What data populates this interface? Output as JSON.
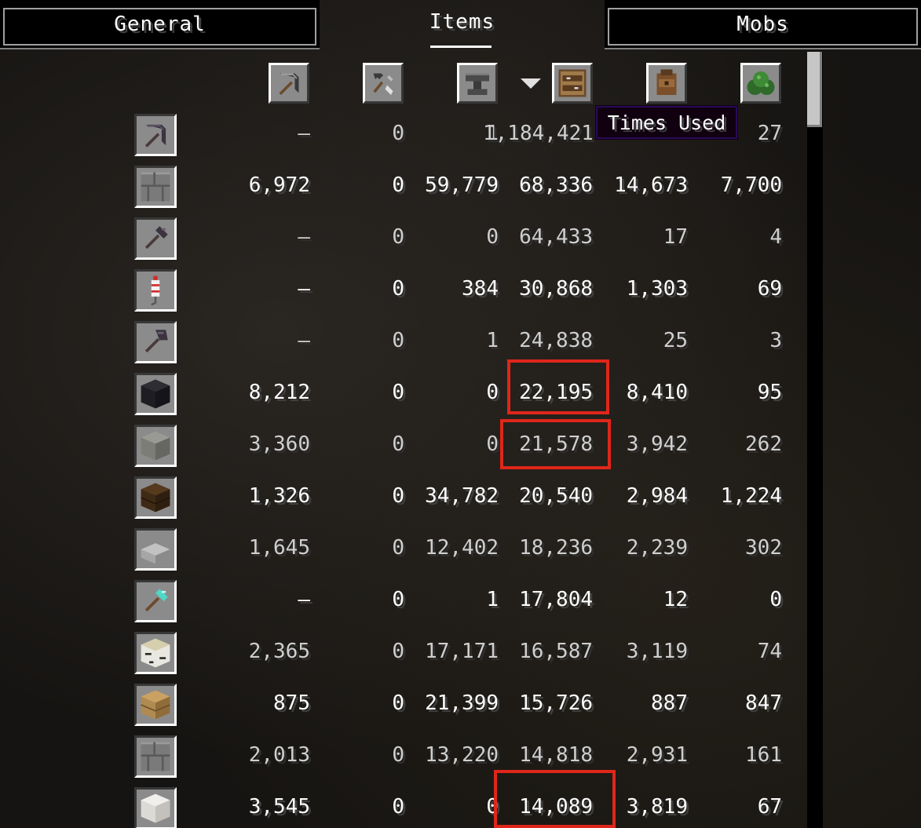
{
  "tabs": [
    {
      "label": "General",
      "active": false
    },
    {
      "label": "Items",
      "active": true
    },
    {
      "label": "Mobs",
      "active": false
    }
  ],
  "columns": [
    {
      "icon": "pickaxe-icon",
      "meaning": "Times Mined"
    },
    {
      "icon": "broken-tool-icon",
      "meaning": "Times Broken"
    },
    {
      "icon": "anvil-icon",
      "meaning": "Times Crafted"
    },
    {
      "icon": "crafting-table-icon",
      "meaning": "Times Used",
      "sorted": "descending"
    },
    {
      "icon": "backpack-icon",
      "meaning": "Times Picked Up"
    },
    {
      "icon": "bush-icon",
      "meaning": "Times Dropped"
    }
  ],
  "tooltip": "Times Used",
  "rows": [
    {
      "item": "netherite-pickaxe-icon",
      "values": [
        "–",
        "0",
        "1",
        "1,184,421",
        "",
        "27"
      ],
      "dim": true
    },
    {
      "item": "stone-bricks-icon",
      "values": [
        "6,972",
        "0",
        "59,779",
        "68,336",
        "14,673",
        "7,700"
      ],
      "dim": false
    },
    {
      "item": "netherite-shovel-icon",
      "values": [
        "–",
        "0",
        "0",
        "64,433",
        "17",
        "4"
      ],
      "dim": true
    },
    {
      "item": "firework-rocket-icon",
      "values": [
        "–",
        "0",
        "384",
        "30,868",
        "1,303",
        "69"
      ],
      "dim": false
    },
    {
      "item": "netherite-axe-icon",
      "values": [
        "–",
        "0",
        "1",
        "24,838",
        "25",
        "3"
      ],
      "dim": true
    },
    {
      "item": "blackstone-icon",
      "values": [
        "8,212",
        "0",
        "0",
        "22,195",
        "8,410",
        "95"
      ],
      "dim": false,
      "highlight": true
    },
    {
      "item": "andesite-icon",
      "values": [
        "3,360",
        "0",
        "0",
        "21,578",
        "3,942",
        "262"
      ],
      "dim": true,
      "highlight": true
    },
    {
      "item": "dark-oak-planks-icon",
      "values": [
        "1,326",
        "0",
        "34,782",
        "20,540",
        "2,984",
        "1,224"
      ],
      "dim": false
    },
    {
      "item": "smooth-stone-slab-icon",
      "values": [
        "1,645",
        "0",
        "12,402",
        "18,236",
        "2,239",
        "302"
      ],
      "dim": true
    },
    {
      "item": "diamond-shovel-icon",
      "values": [
        "–",
        "0",
        "1",
        "17,804",
        "12",
        "0"
      ],
      "dim": false
    },
    {
      "item": "birch-log-icon",
      "values": [
        "2,365",
        "0",
        "17,171",
        "16,587",
        "3,119",
        "74"
      ],
      "dim": true
    },
    {
      "item": "oak-planks-icon",
      "values": [
        "875",
        "0",
        "21,399",
        "15,726",
        "887",
        "847"
      ],
      "dim": false
    },
    {
      "item": "stone-bricks-icon",
      "values": [
        "2,013",
        "0",
        "13,220",
        "14,818",
        "2,931",
        "161"
      ],
      "dim": true
    },
    {
      "item": "smooth-quartz-icon",
      "values": [
        "3,545",
        "0",
        "0",
        "14,089",
        "3,819",
        "67"
      ],
      "dim": false,
      "highlight": true
    }
  ],
  "colors": {
    "highlight": "#e0261a",
    "tooltip_border": "#2a0a5a"
  }
}
